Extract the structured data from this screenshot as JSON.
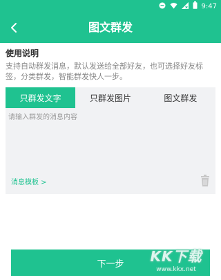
{
  "status": {
    "time": "9:47"
  },
  "header": {
    "title": "图文群发",
    "back_icon": "chevron-left-icon"
  },
  "section": {
    "title": "使用说明",
    "description": "支持自动群发消息，默认发送给全部好友，也可选择好友标签，分类群发，智能群发快人一步。"
  },
  "tabs": [
    {
      "label": "只群发文字",
      "active": true
    },
    {
      "label": "只群发图片",
      "active": false
    },
    {
      "label": "图文群发",
      "active": false
    }
  ],
  "message": {
    "placeholder": "请输入群发的消息内容",
    "value": ""
  },
  "template_link": "消息模板 >",
  "next_button": "下一步",
  "watermark": {
    "logo": "KK下载",
    "url": "www.kkx.net"
  },
  "colors": {
    "accent": "#1fc290",
    "panel_bg": "#f1f2f4",
    "text_muted": "#888888"
  }
}
